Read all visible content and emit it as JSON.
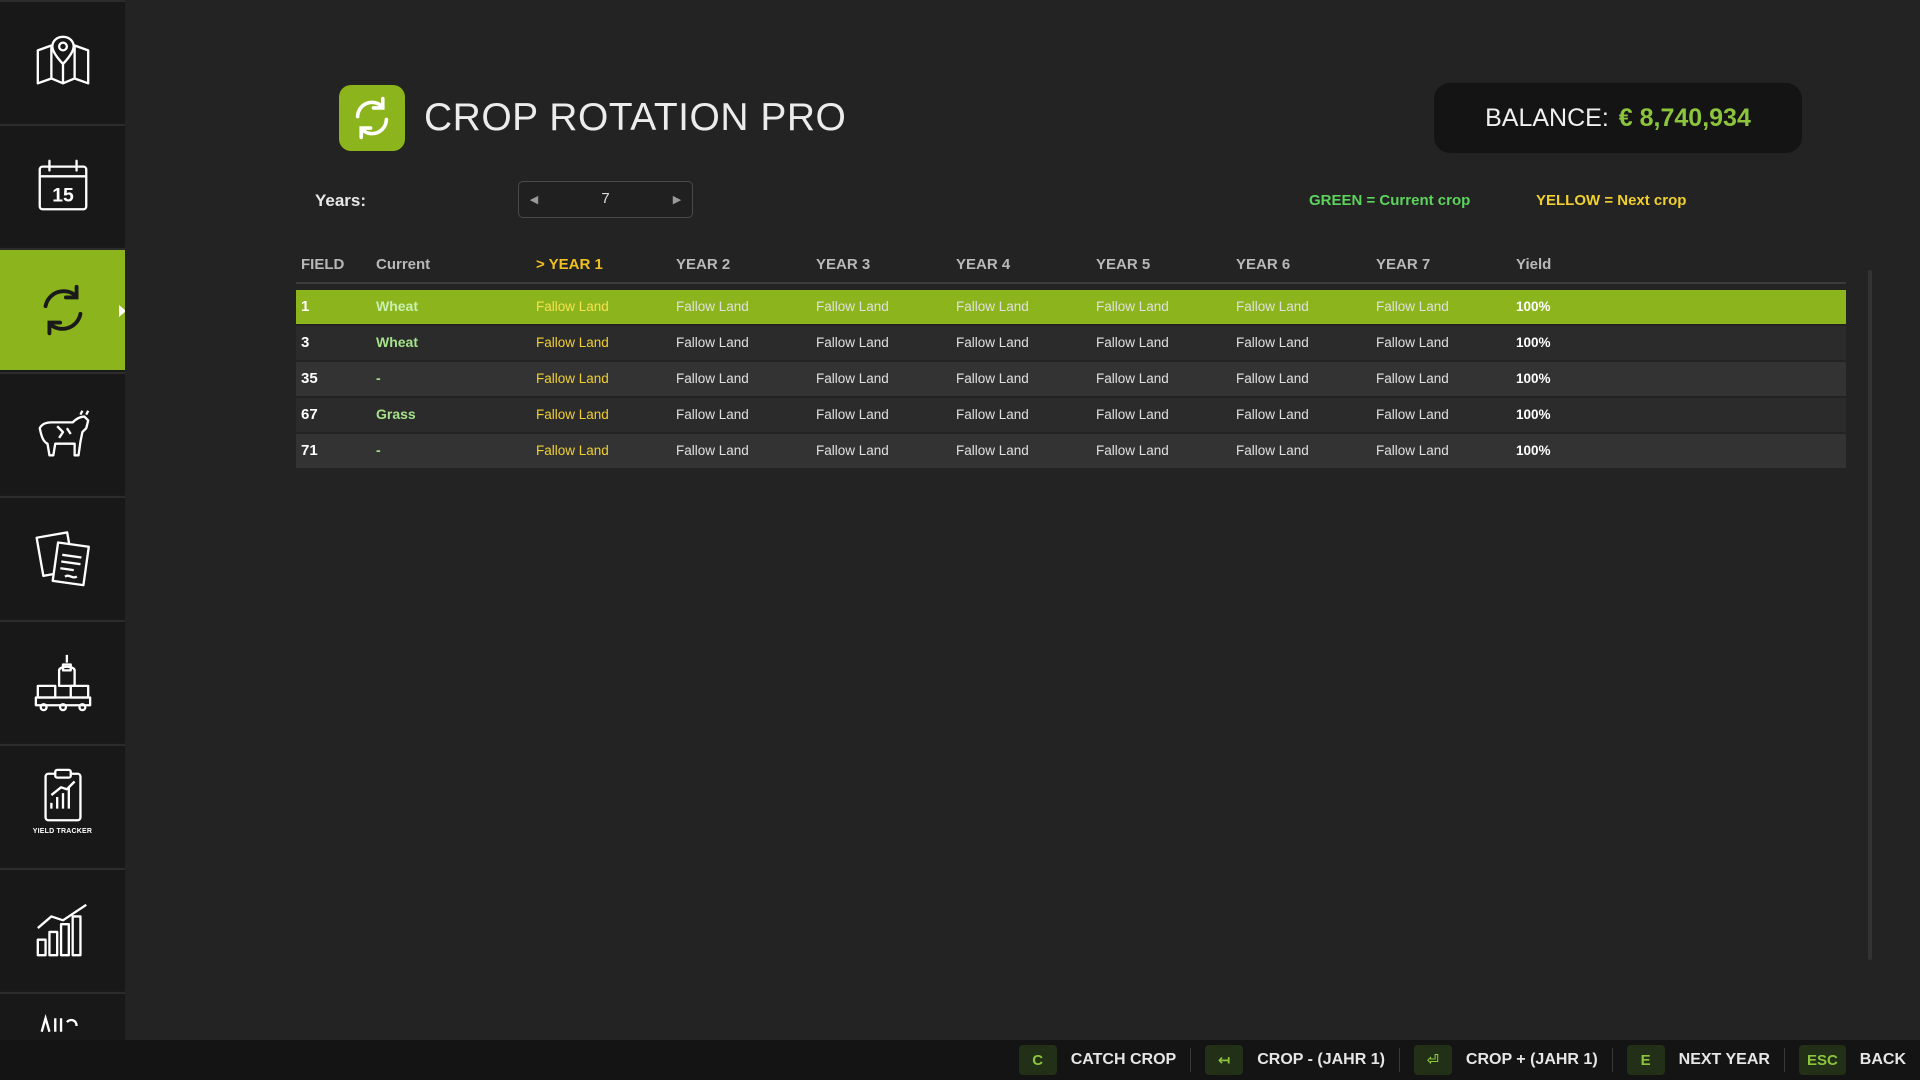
{
  "app": {
    "title": "CROP ROTATION PRO",
    "logo_icon": "rotate-arrows-icon",
    "accent_color": "#8cb41c"
  },
  "balance": {
    "label": "BALANCE:",
    "value": "€ 8,740,934"
  },
  "years": {
    "label": "Years:",
    "value": "7"
  },
  "legend": {
    "green": "GREEN = Current crop",
    "yellow": "YELLOW = Next crop"
  },
  "sidebar": {
    "items": [
      {
        "icon": "map-icon"
      },
      {
        "icon": "calendar-icon",
        "day": "15"
      },
      {
        "icon": "rotation-icon",
        "active": true
      },
      {
        "icon": "cow-icon"
      },
      {
        "icon": "documents-icon"
      },
      {
        "icon": "factory-icon"
      },
      {
        "icon": "yield-tracker-icon",
        "caption": "YIELD TRACKER"
      },
      {
        "icon": "bar-chart-icon"
      },
      {
        "icon": "more-icon"
      }
    ]
  },
  "table": {
    "headers": {
      "field": "FIELD",
      "current": "Current",
      "year1": "> YEAR 1",
      "year2": "YEAR 2",
      "year3": "YEAR 3",
      "year4": "YEAR 4",
      "year5": "YEAR 5",
      "year6": "YEAR 6",
      "year7": "YEAR 7",
      "yield": "Yield"
    },
    "rows": [
      {
        "field": "1",
        "current": "Wheat",
        "y1": "Fallow Land",
        "y2": "Fallow Land",
        "y3": "Fallow Land",
        "y4": "Fallow Land",
        "y5": "Fallow Land",
        "y6": "Fallow Land",
        "y7": "Fallow Land",
        "yield": "100%"
      },
      {
        "field": "3",
        "current": "Wheat",
        "y1": "Fallow Land",
        "y2": "Fallow Land",
        "y3": "Fallow Land",
        "y4": "Fallow Land",
        "y5": "Fallow Land",
        "y6": "Fallow Land",
        "y7": "Fallow Land",
        "yield": "100%"
      },
      {
        "field": "35",
        "current": "-",
        "y1": "Fallow Land",
        "y2": "Fallow Land",
        "y3": "Fallow Land",
        "y4": "Fallow Land",
        "y5": "Fallow Land",
        "y6": "Fallow Land",
        "y7": "Fallow Land",
        "yield": "100%"
      },
      {
        "field": "67",
        "current": "Grass",
        "y1": "Fallow Land",
        "y2": "Fallow Land",
        "y3": "Fallow Land",
        "y4": "Fallow Land",
        "y5": "Fallow Land",
        "y6": "Fallow Land",
        "y7": "Fallow Land",
        "yield": "100%"
      },
      {
        "field": "71",
        "current": "-",
        "y1": "Fallow Land",
        "y2": "Fallow Land",
        "y3": "Fallow Land",
        "y4": "Fallow Land",
        "y5": "Fallow Land",
        "y6": "Fallow Land",
        "y7": "Fallow Land",
        "yield": "100%"
      }
    ]
  },
  "footer": {
    "hints": [
      {
        "key": "C",
        "label": "CATCH CROP"
      },
      {
        "key": "↤",
        "label": "CROP - (JAHR 1)"
      },
      {
        "key": "⏎",
        "label": "CROP + (JAHR 1)"
      },
      {
        "key": "E",
        "label": "NEXT YEAR"
      },
      {
        "key": "ESC",
        "label": "BACK"
      }
    ]
  }
}
